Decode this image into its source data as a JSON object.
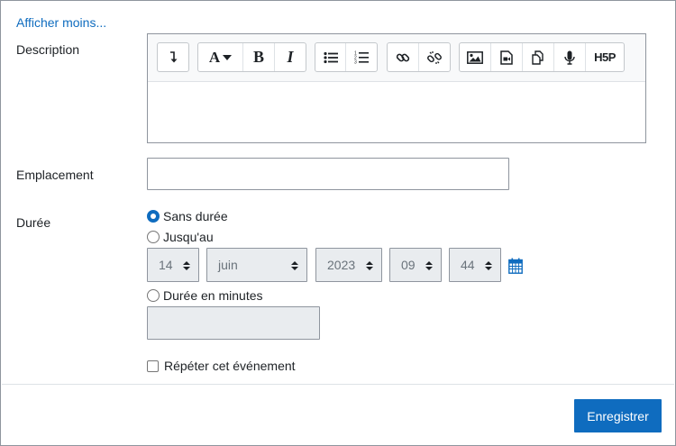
{
  "show_less_link": "Afficher moins...",
  "description": {
    "label": "Description",
    "toolbar": [
      {
        "icon": "expand-toolbar-icon"
      },
      {
        "icon": "font-style-icon",
        "text": "A"
      },
      {
        "icon": "bold-icon",
        "text": "B"
      },
      {
        "icon": "italic-icon",
        "text": "I"
      },
      {
        "icon": "unordered-list-icon"
      },
      {
        "icon": "ordered-list-icon"
      },
      {
        "icon": "link-icon"
      },
      {
        "icon": "unlink-icon"
      },
      {
        "icon": "image-icon"
      },
      {
        "icon": "media-icon"
      },
      {
        "icon": "manage-files-icon"
      },
      {
        "icon": "record-audio-icon"
      },
      {
        "icon": "h5p-icon",
        "text": "H5P"
      }
    ],
    "value": ""
  },
  "location": {
    "label": "Emplacement",
    "value": ""
  },
  "duration": {
    "label": "Durée",
    "options": [
      {
        "label": "Sans durée",
        "checked": true
      },
      {
        "label": "Jusqu'au",
        "checked": false
      },
      {
        "label": "Durée en minutes",
        "checked": false
      }
    ],
    "until": {
      "day": "14",
      "month": "juin",
      "year": "2023",
      "hour": "09",
      "minute": "44"
    },
    "minutes_value": ""
  },
  "repeat": {
    "label": "Répéter cet événement",
    "checked": false
  },
  "save_button": "Enregistrer",
  "colors": {
    "accent": "#0f6cbf",
    "disabled_bg": "#e9ecef"
  }
}
